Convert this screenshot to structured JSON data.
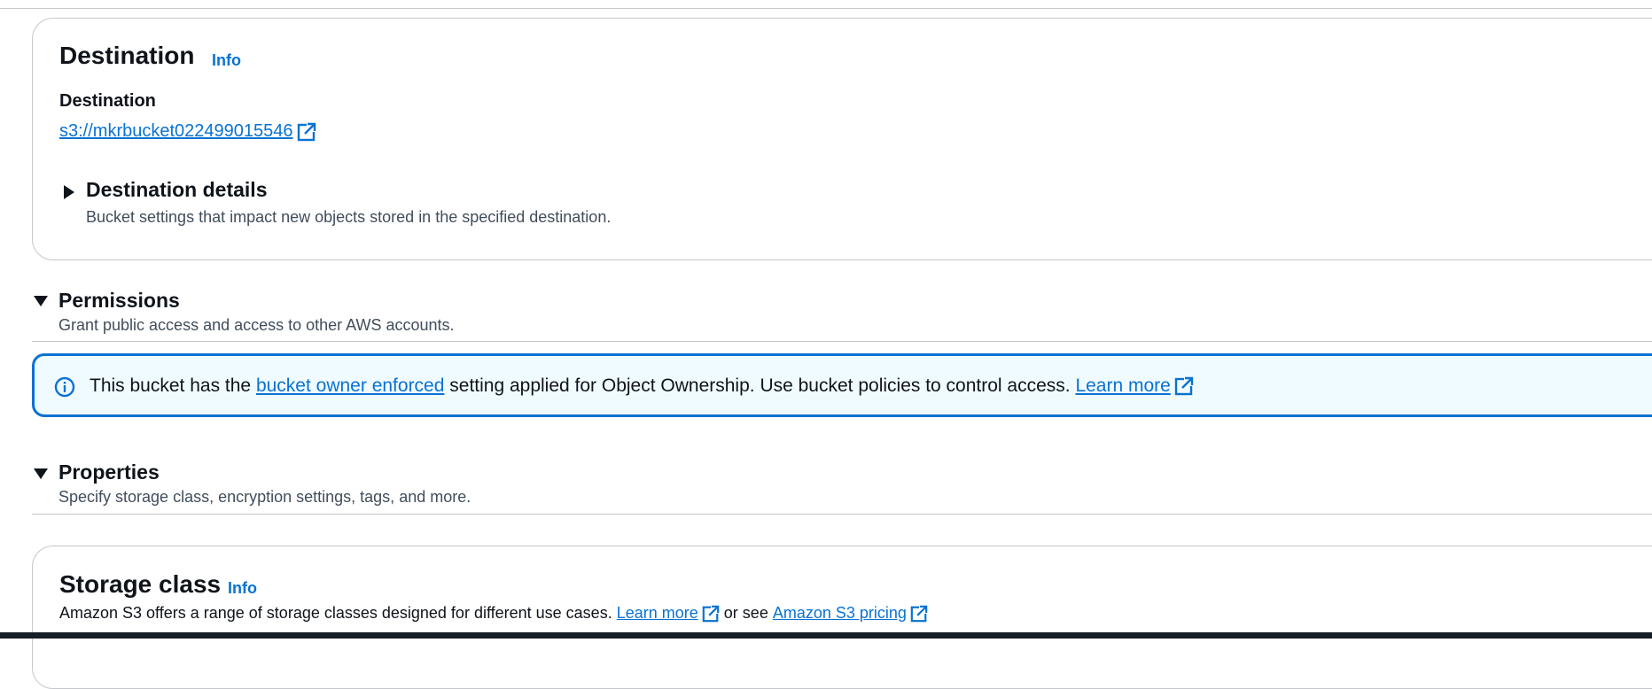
{
  "destination_section": {
    "title": "Destination",
    "info_label": "Info",
    "field_label": "Destination",
    "bucket_link": "s3://mkrbucket022499015546",
    "details": {
      "title": "Destination details",
      "description": "Bucket settings that impact new objects stored in the specified destination."
    }
  },
  "permissions": {
    "title": "Permissions",
    "description": "Grant public access and access to other AWS accounts.",
    "alert": {
      "prefix": "This bucket has the",
      "link": "bucket owner enforced",
      "middle": "setting applied for Object Ownership. Use bucket policies to control access.",
      "learn_more": "Learn more"
    }
  },
  "properties": {
    "title": "Properties",
    "description": "Specify storage class, encryption settings, tags, and more."
  },
  "storage_class": {
    "title": "Storage class",
    "info_label": "Info",
    "description_prefix": "Amazon S3 offers a range of storage classes designed for different use cases.",
    "learn_more": "Learn more",
    "or_see": "or see",
    "pricing_link": "Amazon S3 pricing"
  },
  "icons": {
    "external": "external-link-icon",
    "info": "info-circle-icon",
    "caret_right": "caret-right-icon",
    "caret_down": "caret-down-icon"
  },
  "colors": {
    "link": "#0972d3",
    "alert_bg": "#f0fbff",
    "border": "#c6c6cd"
  }
}
